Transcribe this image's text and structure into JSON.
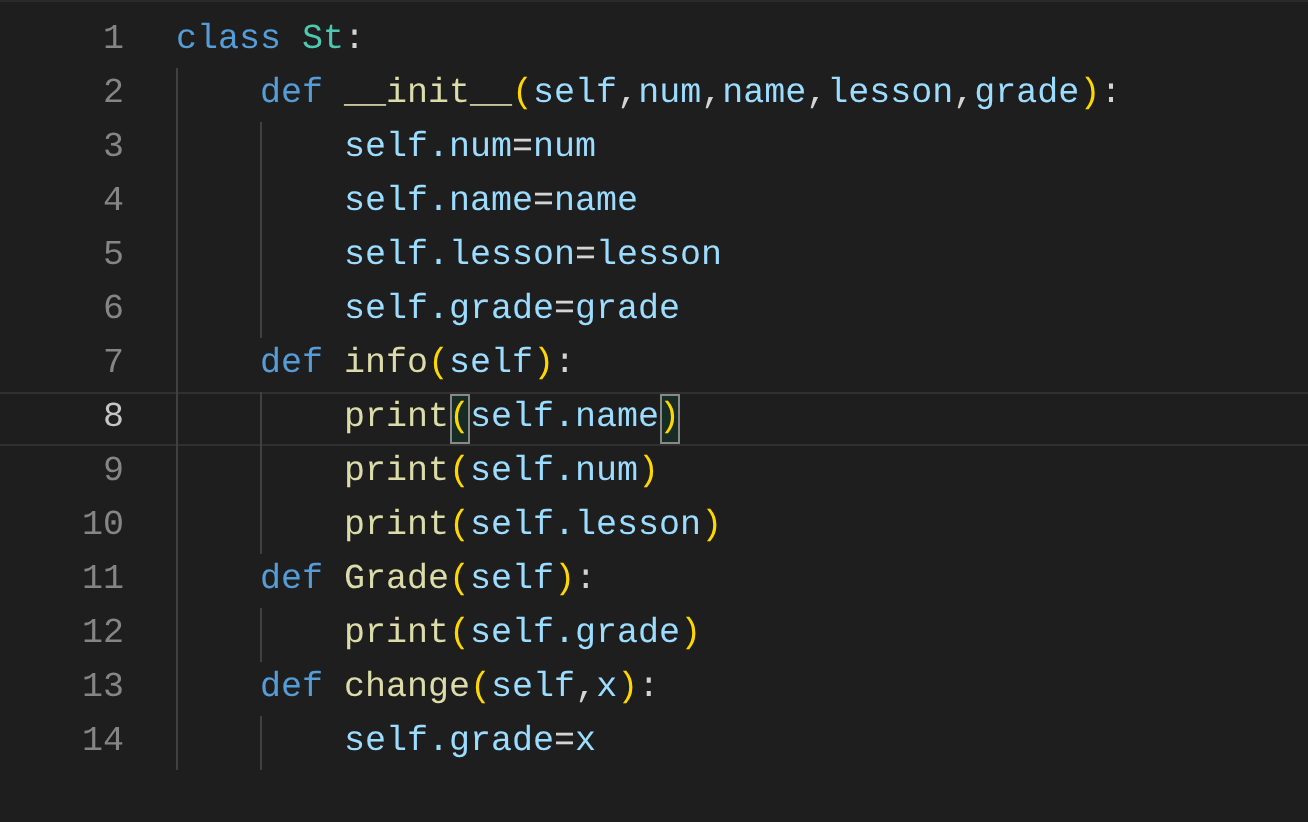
{
  "editor": {
    "lines": [
      {
        "number": "1",
        "current": false,
        "tokens": [
          {
            "kind": "keyword",
            "text": "class"
          },
          {
            "kind": "type",
            "text": "St"
          },
          {
            "kind": "plain",
            "text": ":"
          }
        ],
        "children": [
          {
            "number": "2",
            "current": false,
            "tokens": [
              {
                "kind": "keyword",
                "text": "def"
              },
              {
                "kind": "function",
                "text": "__init__"
              },
              {
                "kind": "bracket",
                "text": "(",
                "matched": false
              },
              {
                "kind": "variable",
                "text": "self"
              },
              {
                "kind": "plain",
                "text": ","
              },
              {
                "kind": "variable",
                "text": "num"
              },
              {
                "kind": "plain",
                "text": ","
              },
              {
                "kind": "variable",
                "text": "name"
              },
              {
                "kind": "plain",
                "text": ","
              },
              {
                "kind": "variable",
                "text": "lesson"
              },
              {
                "kind": "plain",
                "text": ","
              },
              {
                "kind": "variable",
                "text": "grade"
              },
              {
                "kind": "bracket",
                "text": ")",
                "matched": false
              },
              {
                "kind": "plain",
                "text": ":"
              }
            ],
            "children": [
              {
                "number": "3",
                "current": false,
                "tokens": [
                  {
                    "kind": "variable",
                    "text": "self.num"
                  },
                  {
                    "kind": "plain",
                    "text": "="
                  },
                  {
                    "kind": "variable",
                    "text": "num"
                  }
                ]
              },
              {
                "number": "4",
                "current": false,
                "tokens": [
                  {
                    "kind": "variable",
                    "text": "self.name"
                  },
                  {
                    "kind": "plain",
                    "text": "="
                  },
                  {
                    "kind": "variable",
                    "text": "name"
                  }
                ]
              },
              {
                "number": "5",
                "current": false,
                "tokens": [
                  {
                    "kind": "variable",
                    "text": "self.lesson"
                  },
                  {
                    "kind": "plain",
                    "text": "="
                  },
                  {
                    "kind": "variable",
                    "text": "lesson"
                  }
                ]
              },
              {
                "number": "6",
                "current": false,
                "tokens": [
                  {
                    "kind": "variable",
                    "text": "self.grade"
                  },
                  {
                    "kind": "plain",
                    "text": "="
                  },
                  {
                    "kind": "variable",
                    "text": "grade"
                  }
                ]
              }
            ]
          },
          {
            "number": "7",
            "current": false,
            "tokens": [
              {
                "kind": "keyword",
                "text": "def"
              },
              {
                "kind": "function",
                "text": "info"
              },
              {
                "kind": "bracket",
                "text": "(",
                "matched": false
              },
              {
                "kind": "variable",
                "text": "self"
              },
              {
                "kind": "bracket",
                "text": ")",
                "matched": false
              },
              {
                "kind": "plain",
                "text": ":"
              }
            ],
            "children": [
              {
                "number": "8",
                "current": true,
                "tokens": [
                  {
                    "kind": "function",
                    "text": "print"
                  },
                  {
                    "kind": "bracket",
                    "text": "(",
                    "matched": true
                  },
                  {
                    "kind": "variable",
                    "text": "self.name"
                  },
                  {
                    "kind": "bracket",
                    "text": ")",
                    "matched": true
                  }
                ]
              },
              {
                "number": "9",
                "current": false,
                "tokens": [
                  {
                    "kind": "function",
                    "text": "print"
                  },
                  {
                    "kind": "bracket",
                    "text": "(",
                    "matched": false
                  },
                  {
                    "kind": "variable",
                    "text": "self.num"
                  },
                  {
                    "kind": "bracket",
                    "text": ")",
                    "matched": false
                  }
                ]
              },
              {
                "number": "10",
                "current": false,
                "tokens": [
                  {
                    "kind": "function",
                    "text": "print"
                  },
                  {
                    "kind": "bracket",
                    "text": "(",
                    "matched": false
                  },
                  {
                    "kind": "variable",
                    "text": "self.lesson"
                  },
                  {
                    "kind": "bracket",
                    "text": ")",
                    "matched": false
                  }
                ]
              }
            ]
          },
          {
            "number": "11",
            "current": false,
            "tokens": [
              {
                "kind": "keyword",
                "text": "def"
              },
              {
                "kind": "function",
                "text": "Grade"
              },
              {
                "kind": "bracket",
                "text": "(",
                "matched": false
              },
              {
                "kind": "variable",
                "text": "self"
              },
              {
                "kind": "bracket",
                "text": ")",
                "matched": false
              },
              {
                "kind": "plain",
                "text": ":"
              }
            ],
            "children": [
              {
                "number": "12",
                "current": false,
                "tokens": [
                  {
                    "kind": "function",
                    "text": "print"
                  },
                  {
                    "kind": "bracket",
                    "text": "(",
                    "matched": false
                  },
                  {
                    "kind": "variable",
                    "text": "self.grade"
                  },
                  {
                    "kind": "bracket",
                    "text": ")",
                    "matched": false
                  }
                ]
              }
            ]
          },
          {
            "number": "13",
            "current": false,
            "tokens": [
              {
                "kind": "keyword",
                "text": "def"
              },
              {
                "kind": "function",
                "text": "change"
              },
              {
                "kind": "bracket",
                "text": "(",
                "matched": false
              },
              {
                "kind": "variable",
                "text": "self"
              },
              {
                "kind": "plain",
                "text": ","
              },
              {
                "kind": "variable",
                "text": "x"
              },
              {
                "kind": "bracket",
                "text": ")",
                "matched": false
              },
              {
                "kind": "plain",
                "text": ":"
              }
            ],
            "children": [
              {
                "number": "14",
                "current": false,
                "tokens": [
                  {
                    "kind": "variable",
                    "text": "self.grade"
                  },
                  {
                    "kind": "plain",
                    "text": "="
                  },
                  {
                    "kind": "variable",
                    "text": "x"
                  }
                ]
              }
            ]
          }
        ]
      }
    ]
  }
}
